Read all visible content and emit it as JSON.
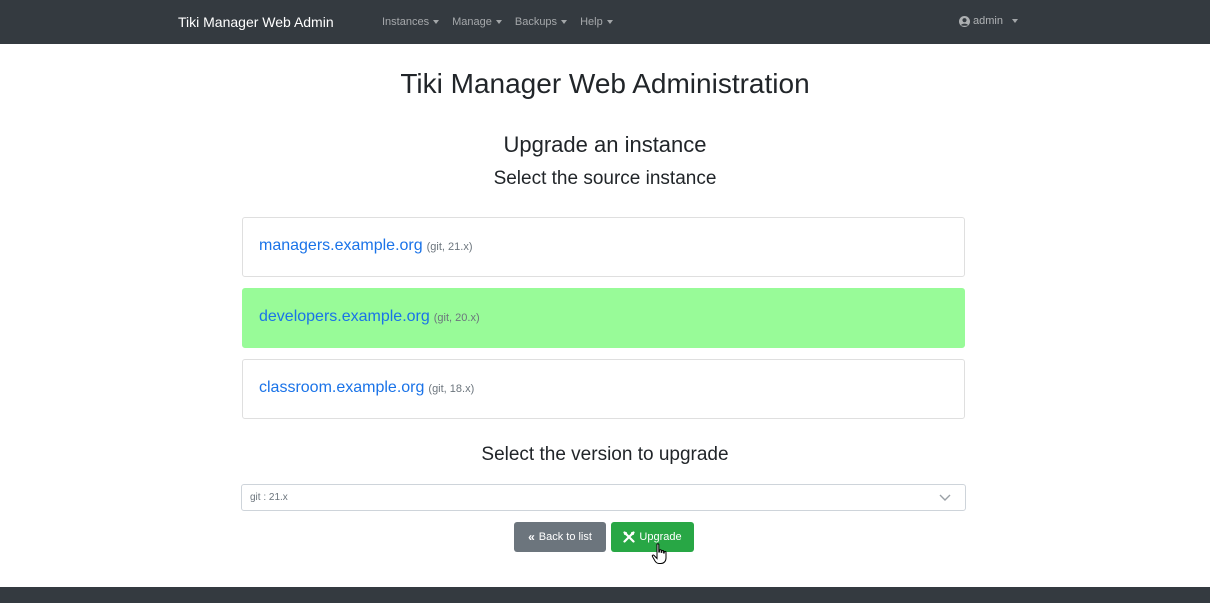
{
  "navbar": {
    "brand": "Tiki Manager Web Admin",
    "menus": [
      {
        "label": "Instances"
      },
      {
        "label": "Manage"
      },
      {
        "label": "Backups"
      },
      {
        "label": "Help"
      }
    ],
    "user": "admin"
  },
  "page": {
    "title": "Tiki Manager Web Administration",
    "section_title": "Upgrade an instance",
    "section_subtitle": "Select the source instance"
  },
  "instances": [
    {
      "name": "managers.example.org",
      "meta": "(git, 21.x)",
      "selected": false
    },
    {
      "name": "developers.example.org",
      "meta": "(git, 20.x)",
      "selected": true
    },
    {
      "name": "classroom.example.org",
      "meta": "(git, 18.x)",
      "selected": false
    }
  ],
  "version": {
    "title": "Select the version to upgrade",
    "selected": "git : 21.x"
  },
  "buttons": {
    "back": "Back to list",
    "upgrade": "Upgrade"
  },
  "colors": {
    "navbar": "#343a40",
    "selected_instance": "#98fb98",
    "link": "#1a73e8",
    "upgrade_button": "#28a745",
    "back_button": "#6c757d"
  }
}
